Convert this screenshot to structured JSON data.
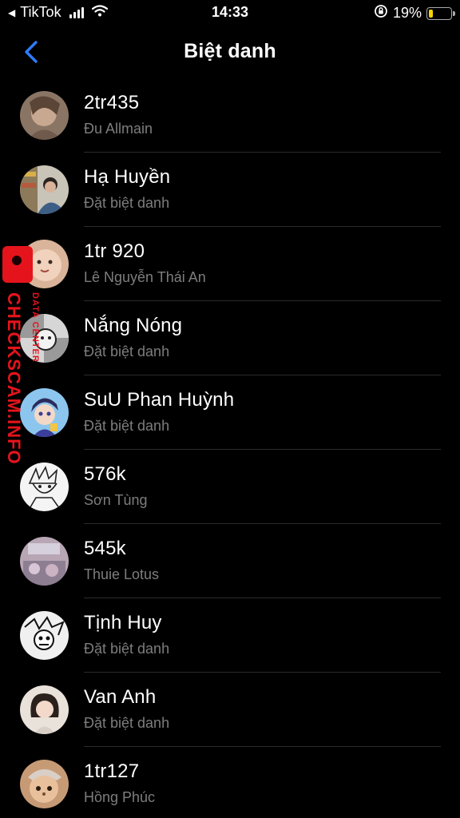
{
  "status_bar": {
    "back_app": "TikTok",
    "time": "14:33",
    "battery_percent": "19%",
    "battery_level": 0.19,
    "signal_icon": "signal-bars-icon",
    "wifi_icon": "wifi-icon",
    "rotation_lock_icon": "rotation-lock-icon"
  },
  "nav": {
    "title": "Biệt danh",
    "back_icon": "chevron-left-icon",
    "accent_color": "#2f7cf6"
  },
  "members": [
    {
      "name": "2tr435",
      "subtitle": "Đu Allmain"
    },
    {
      "name": "Hạ Huyền",
      "subtitle": "Đặt biệt danh"
    },
    {
      "name": "1tr 920",
      "subtitle": "Lê Nguyễn Thái An"
    },
    {
      "name": "Nắng Nóng",
      "subtitle": "Đặt biệt danh"
    },
    {
      "name": "SuU Phan Huỳnh",
      "subtitle": "Đặt biệt danh"
    },
    {
      "name": "576k",
      "subtitle": "Sơn Tùng"
    },
    {
      "name": "545k",
      "subtitle": "Thuie Lotus"
    },
    {
      "name": "Tịnh Huy",
      "subtitle": "Đặt biệt danh"
    },
    {
      "name": "Van Anh",
      "subtitle": "Đặt biệt danh"
    },
    {
      "name": "1tr127",
      "subtitle": "Hồng Phúc"
    }
  ],
  "watermark": {
    "main": "CHECKSCAM.INFO",
    "sub": "DATA CENTER",
    "color": "#e5141c"
  }
}
